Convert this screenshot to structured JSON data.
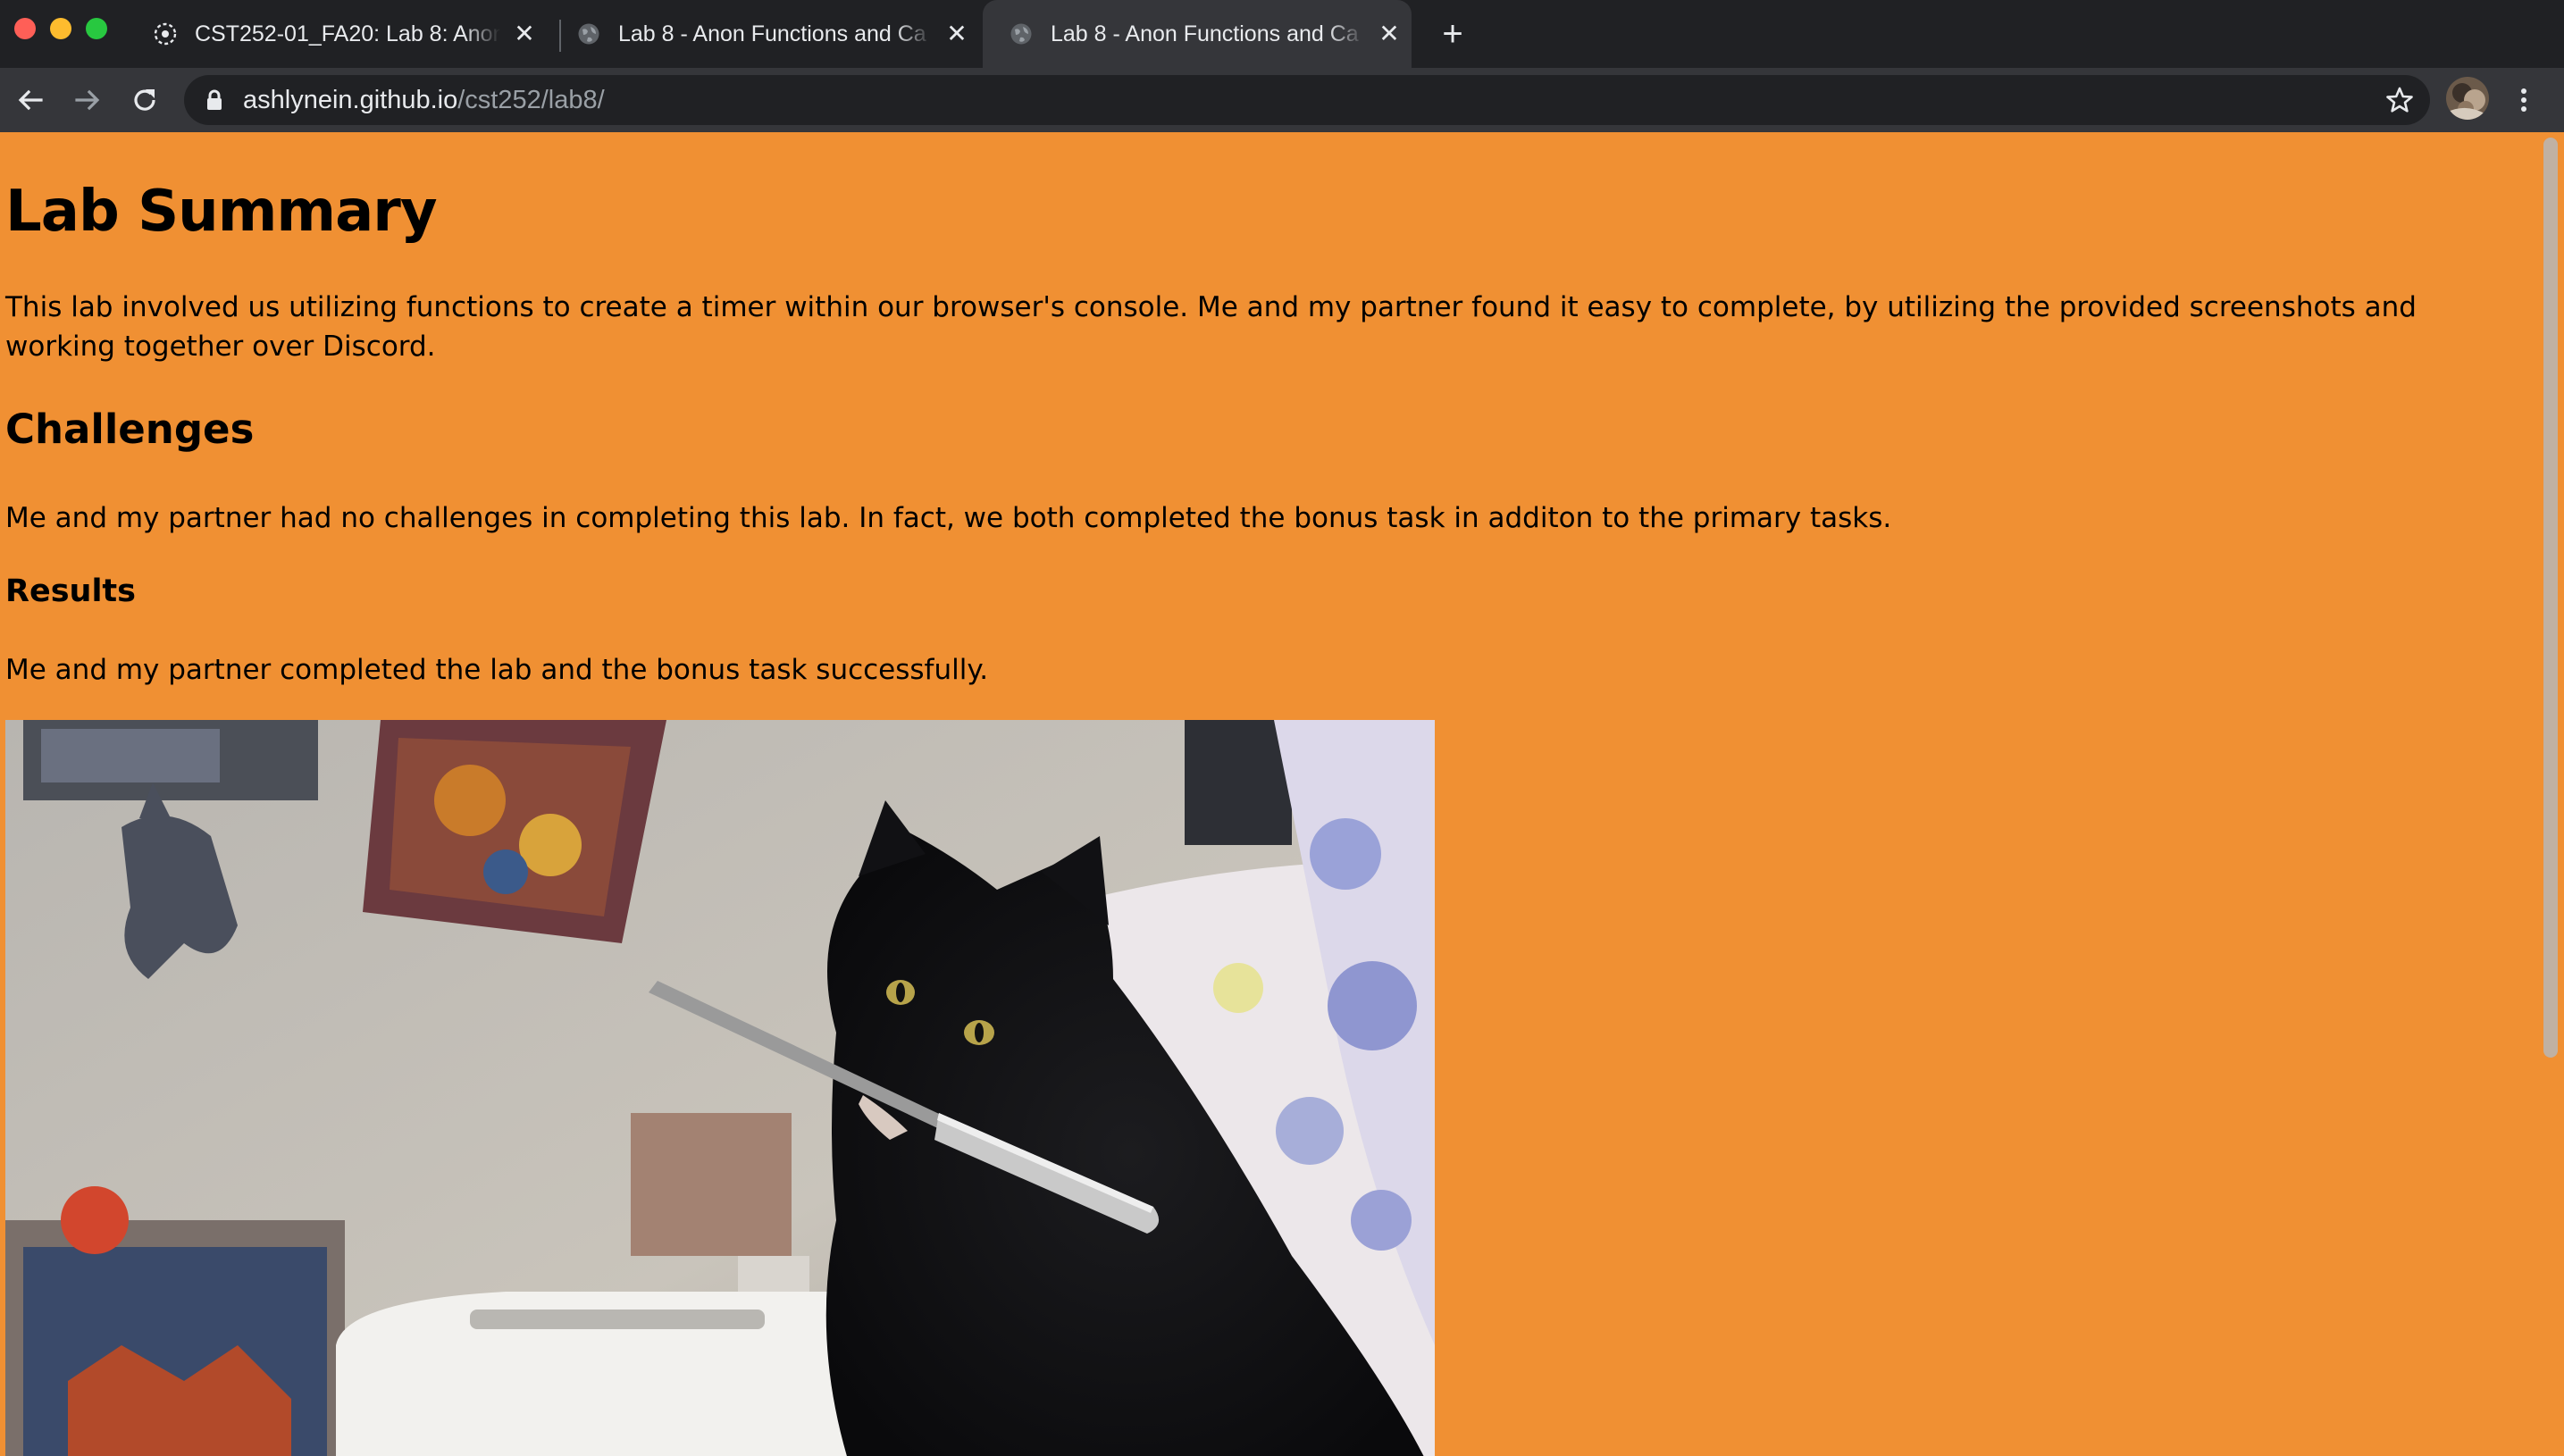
{
  "browser": {
    "tabs": [
      {
        "title": "CST252-01_FA20: Lab 8: Anon",
        "icon": "canvas-favicon-icon",
        "active": false
      },
      {
        "title": "Lab 8 - Anon Functions and Ca",
        "icon": "globe-icon",
        "active": false
      },
      {
        "title": "Lab 8 - Anon Functions and Ca",
        "icon": "globe-icon",
        "active": true
      }
    ],
    "close_glyph": "✕",
    "new_tab_glyph": "+",
    "url": {
      "host": "ashlynein.github.io",
      "path": "/cst252/lab8/"
    },
    "icons": {
      "back": "back-arrow-icon",
      "forward": "forward-arrow-icon",
      "reload": "reload-icon",
      "lock": "lock-icon",
      "bookmark": "star-icon",
      "menu": "kebab-menu-icon"
    }
  },
  "page": {
    "background_color": "#f09033",
    "title": "Lab Summary",
    "summary": "This lab involved us utilizing functions to create a timer within our browser's console. Me and my partner found it easy to complete, by utilizing the provided screenshots and working together over Discord.",
    "challenges_heading": "Challenges",
    "challenges_text": "Me and my partner had no challenges in completing this lab. In fact, we both completed the bonus task in additon to the primary tasks.",
    "results_heading": "Results",
    "results_text": "Me and my partner completed the lab and the bonus task successfully."
  }
}
